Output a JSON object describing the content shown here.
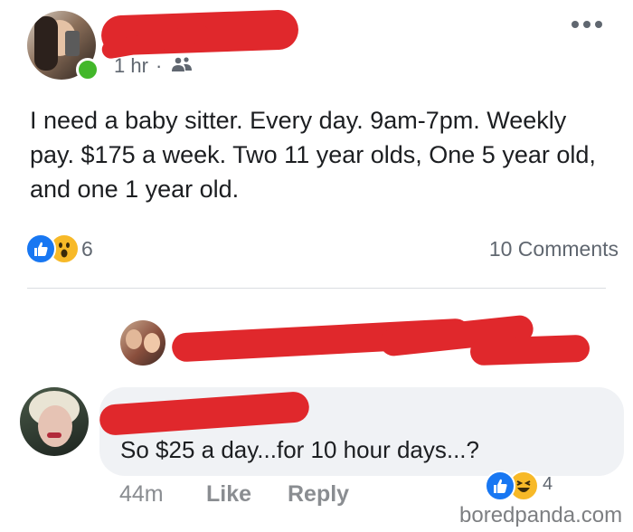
{
  "post": {
    "timestamp": "1 hr",
    "separator": "·",
    "audience_icon": "friends-icon",
    "more_icon": "more-dots-icon",
    "text": "I need a baby sitter. Every day. 9am-7pm. Weekly pay. $175 a week. Two 11 year olds, One 5 year old, and one 1 year old.",
    "reaction_count": "6",
    "reaction_icons": [
      "like-icon",
      "wow-icon"
    ],
    "comments_label": "10 Comments"
  },
  "comment": {
    "text": "So $25 a day...for 10 hour days...?",
    "time": "44m",
    "like_label": "Like",
    "reply_label": "Reply",
    "reaction_count": "4",
    "reaction_icons": [
      "like-icon",
      "haha-icon"
    ]
  },
  "colors": {
    "redaction": "#e0282c",
    "online": "#42b72a",
    "like_blue": "#1877f2",
    "wow_yellow": "#f7b928"
  },
  "watermark": "boredpanda.com"
}
